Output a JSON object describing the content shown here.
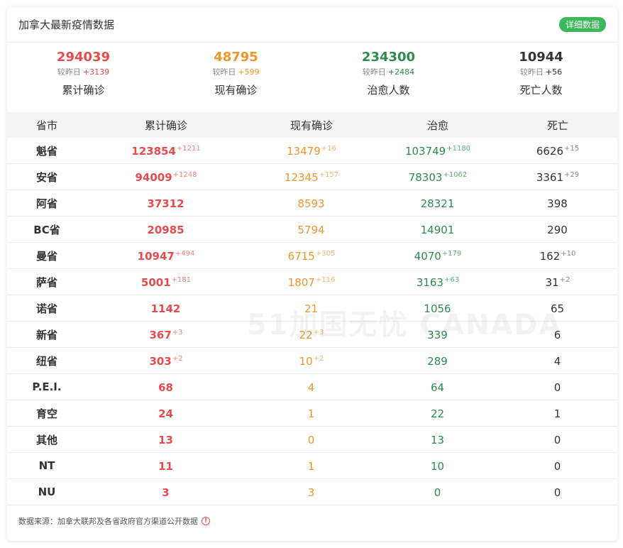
{
  "header": {
    "title": "加拿大最新疫情数据",
    "detail_button": "详细数据"
  },
  "colors": {
    "red": "#e84b4b",
    "orange": "#f0942c",
    "green": "#2e8a4f",
    "dark": "#333333",
    "button": "#3cb85c"
  },
  "summary": [
    {
      "value": "294039",
      "diff_label": "较昨日",
      "diff": "+3139",
      "label": "累计确诊",
      "color": "red"
    },
    {
      "value": "48795",
      "diff_label": "较昨日",
      "diff": "+599",
      "label": "现有确诊",
      "color": "orange"
    },
    {
      "value": "234300",
      "diff_label": "较昨日",
      "diff": "+2484",
      "label": "治愈人数",
      "color": "green"
    },
    {
      "value": "10944",
      "diff_label": "较昨日",
      "diff": "+56",
      "label": "死亡人数",
      "color": "dark"
    }
  ],
  "table": {
    "headers": [
      "省市",
      "累计确诊",
      "现有确诊",
      "治愈",
      "死亡"
    ],
    "rows": [
      {
        "province": "魁省",
        "confirmed": "123854",
        "confirmed_inc": "+1211",
        "active": "13479",
        "active_inc": "+16",
        "cured": "103749",
        "cured_inc": "+1180",
        "dead": "6626",
        "dead_inc": "+15"
      },
      {
        "province": "安省",
        "confirmed": "94009",
        "confirmed_inc": "+1248",
        "active": "12345",
        "active_inc": "+157",
        "cured": "78303",
        "cured_inc": "+1062",
        "dead": "3361",
        "dead_inc": "+29"
      },
      {
        "province": "阿省",
        "confirmed": "37312",
        "confirmed_inc": "",
        "active": "8593",
        "active_inc": "",
        "cured": "28321",
        "cured_inc": "",
        "dead": "398",
        "dead_inc": ""
      },
      {
        "province": "BC省",
        "confirmed": "20985",
        "confirmed_inc": "",
        "active": "5794",
        "active_inc": "",
        "cured": "14901",
        "cured_inc": "",
        "dead": "290",
        "dead_inc": ""
      },
      {
        "province": "曼省",
        "confirmed": "10947",
        "confirmed_inc": "+494",
        "active": "6715",
        "active_inc": "+305",
        "cured": "4070",
        "cured_inc": "+179",
        "dead": "162",
        "dead_inc": "+10"
      },
      {
        "province": "萨省",
        "confirmed": "5001",
        "confirmed_inc": "+181",
        "active": "1807",
        "active_inc": "+116",
        "cured": "3163",
        "cured_inc": "+63",
        "dead": "31",
        "dead_inc": "+2"
      },
      {
        "province": "诺省",
        "confirmed": "1142",
        "confirmed_inc": "",
        "active": "21",
        "active_inc": "",
        "cured": "1056",
        "cured_inc": "",
        "dead": "65",
        "dead_inc": ""
      },
      {
        "province": "新省",
        "confirmed": "367",
        "confirmed_inc": "+3",
        "active": "22",
        "active_inc": "+3",
        "cured": "339",
        "cured_inc": "",
        "dead": "6",
        "dead_inc": ""
      },
      {
        "province": "纽省",
        "confirmed": "303",
        "confirmed_inc": "+2",
        "active": "10",
        "active_inc": "+2",
        "cured": "289",
        "cured_inc": "",
        "dead": "4",
        "dead_inc": ""
      },
      {
        "province": "P.E.I.",
        "confirmed": "68",
        "confirmed_inc": "",
        "active": "4",
        "active_inc": "",
        "cured": "64",
        "cured_inc": "",
        "dead": "0",
        "dead_inc": ""
      },
      {
        "province": "育空",
        "confirmed": "24",
        "confirmed_inc": "",
        "active": "1",
        "active_inc": "",
        "cured": "22",
        "cured_inc": "",
        "dead": "1",
        "dead_inc": ""
      },
      {
        "province": "其他",
        "confirmed": "13",
        "confirmed_inc": "",
        "active": "0",
        "active_inc": "",
        "cured": "13",
        "cured_inc": "",
        "dead": "0",
        "dead_inc": ""
      },
      {
        "province": "NT",
        "confirmed": "11",
        "confirmed_inc": "",
        "active": "1",
        "active_inc": "",
        "cured": "10",
        "cured_inc": "",
        "dead": "0",
        "dead_inc": ""
      },
      {
        "province": "NU",
        "confirmed": "3",
        "confirmed_inc": "",
        "active": "3",
        "active_inc": "",
        "cured": "0",
        "cured_inc": "",
        "dead": "0",
        "dead_inc": ""
      }
    ]
  },
  "footer": {
    "source": "数据来源：加拿大联邦及各省政府官方渠道公开数据",
    "info_icon": "info-icon"
  },
  "watermark": "51加国无忧 CANADA"
}
